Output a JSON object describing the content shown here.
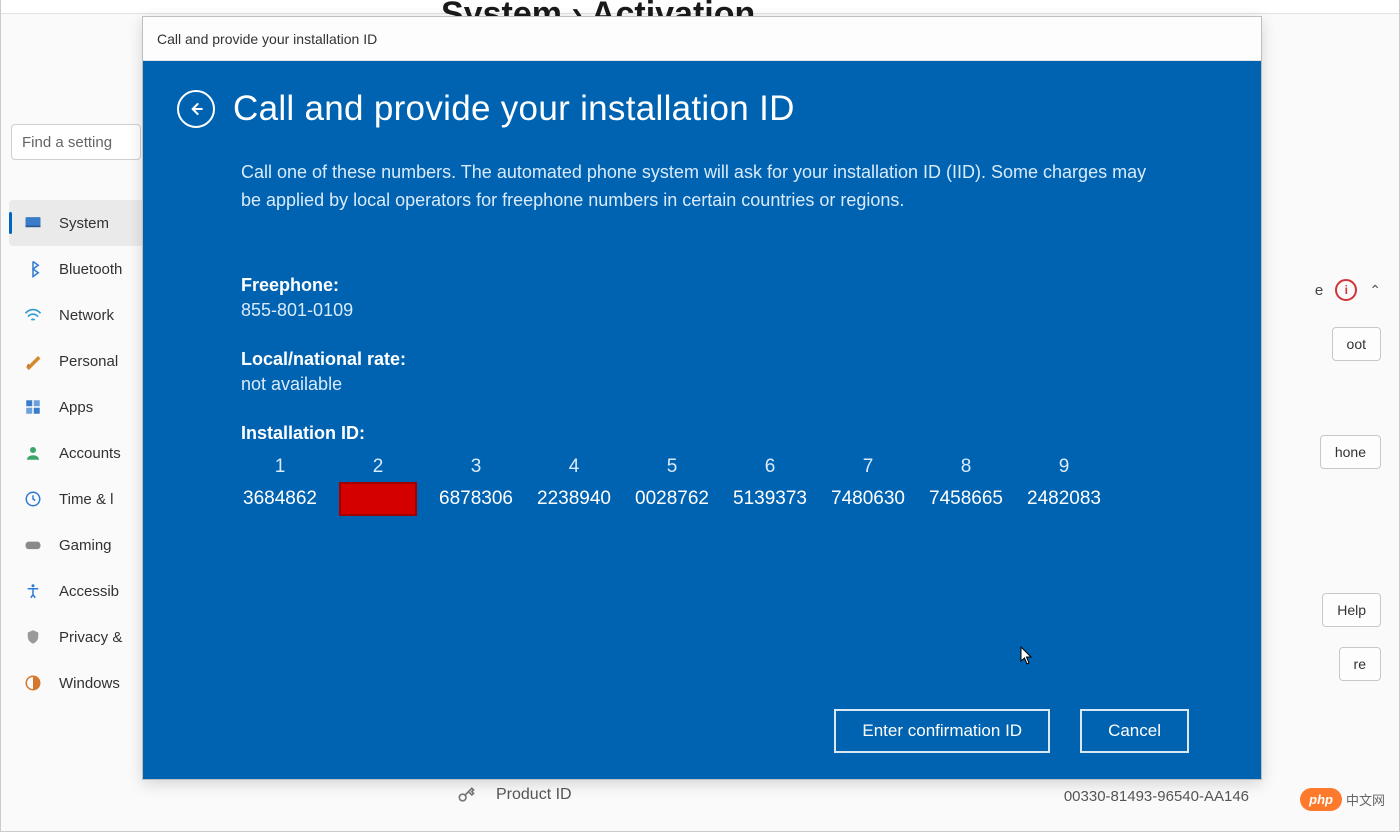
{
  "background": {
    "partial_title": "System › Activation",
    "search_placeholder": "Find a setting",
    "sidebar": [
      {
        "label": "System",
        "active": true
      },
      {
        "label": "Bluetooth",
        "active": false
      },
      {
        "label": "Network",
        "active": false
      },
      {
        "label": "Personal",
        "active": false
      },
      {
        "label": "Apps",
        "active": false
      },
      {
        "label": "Accounts",
        "active": false
      },
      {
        "label": "Time & l",
        "active": false
      },
      {
        "label": "Gaming",
        "active": false
      },
      {
        "label": "Accessib",
        "active": false
      },
      {
        "label": "Privacy &",
        "active": false
      },
      {
        "label": "Windows",
        "active": false
      }
    ],
    "right_items": {
      "e_text": "e",
      "chevron": "⌃",
      "btn1": "oot",
      "btn2": "hone",
      "btn3": "Help",
      "btn4": "re"
    },
    "product_label": "Product ID",
    "product_id": "00330-81493-96540-AA146"
  },
  "dialog": {
    "window_title": "Call and provide your installation ID",
    "title": "Call and provide your installation ID",
    "description": "Call one of these numbers. The automated phone system will ask for your installation ID (IID). Some charges may be applied by local operators for freephone numbers in certain countries or regions.",
    "freephone_label": "Freephone:",
    "freephone_value": "855-801-0109",
    "national_label": "Local/national rate:",
    "national_value": "not available",
    "iid_label": "Installation ID:",
    "iid_headers": [
      "1",
      "2",
      "3",
      "4",
      "5",
      "6",
      "7",
      "8",
      "9"
    ],
    "iid_values": [
      "3684862",
      "",
      "6878306",
      "2238940",
      "0028762",
      "5139373",
      "7480630",
      "7458665",
      "2482083"
    ],
    "iid_redacted_index": 1,
    "btn_confirm": "Enter confirmation ID",
    "btn_cancel": "Cancel"
  },
  "watermark": {
    "badge": "php",
    "text": "中文网"
  }
}
